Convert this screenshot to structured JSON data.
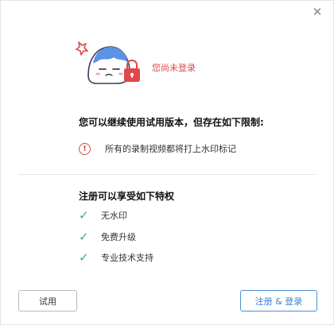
{
  "dialog": {
    "close_label": "✕",
    "status_text": "您尚未登录",
    "limits_title": "您可以继续使用试用版本，但存在如下限制:",
    "limits": [
      {
        "icon": "alert-circle-icon",
        "text": "所有的录制视频都将打上水印标记"
      }
    ],
    "privileges_title": "注册可以享受如下特权",
    "privileges": [
      {
        "icon": "check-icon",
        "text": "无水印"
      },
      {
        "icon": "check-icon",
        "text": "免费升级"
      },
      {
        "icon": "check-icon",
        "text": "专业技术支持"
      }
    ],
    "buttons": {
      "trial_label": "试用",
      "register_label": "注册 & 登录"
    }
  },
  "colors": {
    "status_red": "#e0474a",
    "check_green": "#2eb86b",
    "primary_blue": "#3a7fd0"
  }
}
